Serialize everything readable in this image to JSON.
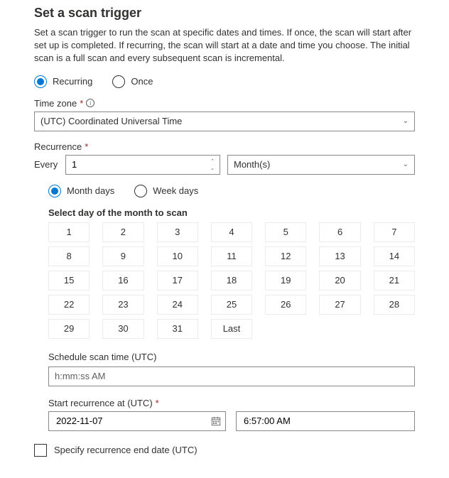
{
  "title": "Set a scan trigger",
  "description": "Set a scan trigger to run the scan at specific dates and times. If once, the scan will start after set up is completed. If recurring, the scan will start at a date and time you choose. The initial scan is a full scan and every subsequent scan is incremental.",
  "triggerType": {
    "recurring": "Recurring",
    "once": "Once",
    "selected": "recurring"
  },
  "timezone": {
    "label": "Time zone",
    "value": "(UTC) Coordinated Universal Time"
  },
  "recurrence": {
    "label": "Recurrence",
    "everyLabel": "Every",
    "everyValue": "1",
    "unit": "Month(s)"
  },
  "dayMode": {
    "monthDays": "Month days",
    "weekDays": "Week days",
    "selected": "monthDays"
  },
  "selectDayLabel": "Select day of the month to scan",
  "days": [
    "1",
    "2",
    "3",
    "4",
    "5",
    "6",
    "7",
    "8",
    "9",
    "10",
    "11",
    "12",
    "13",
    "14",
    "15",
    "16",
    "17",
    "18",
    "19",
    "20",
    "21",
    "22",
    "23",
    "24",
    "25",
    "26",
    "27",
    "28",
    "29",
    "30",
    "31",
    "Last"
  ],
  "scheduleTime": {
    "label": "Schedule scan time (UTC)",
    "placeholder": "h:mm:ss AM"
  },
  "startRecurrence": {
    "label": "Start recurrence at (UTC)",
    "date": "2022-11-07",
    "time": "6:57:00 AM"
  },
  "endDate": {
    "label": "Specify recurrence end date (UTC)",
    "checked": false
  }
}
